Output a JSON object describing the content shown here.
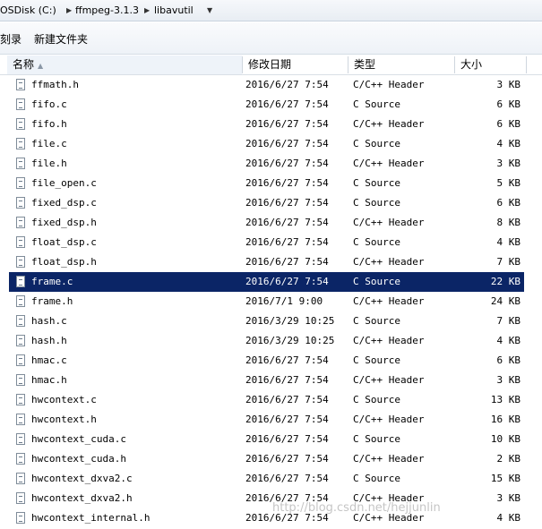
{
  "breadcrumb": [
    "OSDisk (C:)",
    "ffmpeg-3.1.3",
    "libavutil"
  ],
  "toolbar": {
    "left_label": "刻录",
    "new_folder_label": "新建文件夹"
  },
  "columns": {
    "name": "名称",
    "date": "修改日期",
    "type": "类型",
    "size": "大小"
  },
  "files": [
    {
      "name": "ffmath.h",
      "date": "2016/6/27 7:54",
      "type": "C/C++ Header",
      "size": "3 KB"
    },
    {
      "name": "fifo.c",
      "date": "2016/6/27 7:54",
      "type": "C Source",
      "size": "6 KB"
    },
    {
      "name": "fifo.h",
      "date": "2016/6/27 7:54",
      "type": "C/C++ Header",
      "size": "6 KB"
    },
    {
      "name": "file.c",
      "date": "2016/6/27 7:54",
      "type": "C Source",
      "size": "4 KB"
    },
    {
      "name": "file.h",
      "date": "2016/6/27 7:54",
      "type": "C/C++ Header",
      "size": "3 KB"
    },
    {
      "name": "file_open.c",
      "date": "2016/6/27 7:54",
      "type": "C Source",
      "size": "5 KB"
    },
    {
      "name": "fixed_dsp.c",
      "date": "2016/6/27 7:54",
      "type": "C Source",
      "size": "6 KB"
    },
    {
      "name": "fixed_dsp.h",
      "date": "2016/6/27 7:54",
      "type": "C/C++ Header",
      "size": "8 KB"
    },
    {
      "name": "float_dsp.c",
      "date": "2016/6/27 7:54",
      "type": "C Source",
      "size": "4 KB"
    },
    {
      "name": "float_dsp.h",
      "date": "2016/6/27 7:54",
      "type": "C/C++ Header",
      "size": "7 KB"
    },
    {
      "name": "frame.c",
      "date": "2016/6/27 7:54",
      "type": "C Source",
      "size": "22 KB",
      "selected": true
    },
    {
      "name": "frame.h",
      "date": "2016/7/1 9:00",
      "type": "C/C++ Header",
      "size": "24 KB"
    },
    {
      "name": "hash.c",
      "date": "2016/3/29 10:25",
      "type": "C Source",
      "size": "7 KB"
    },
    {
      "name": "hash.h",
      "date": "2016/3/29 10:25",
      "type": "C/C++ Header",
      "size": "4 KB"
    },
    {
      "name": "hmac.c",
      "date": "2016/6/27 7:54",
      "type": "C Source",
      "size": "6 KB"
    },
    {
      "name": "hmac.h",
      "date": "2016/6/27 7:54",
      "type": "C/C++ Header",
      "size": "3 KB"
    },
    {
      "name": "hwcontext.c",
      "date": "2016/6/27 7:54",
      "type": "C Source",
      "size": "13 KB"
    },
    {
      "name": "hwcontext.h",
      "date": "2016/6/27 7:54",
      "type": "C/C++ Header",
      "size": "16 KB"
    },
    {
      "name": "hwcontext_cuda.c",
      "date": "2016/6/27 7:54",
      "type": "C Source",
      "size": "10 KB"
    },
    {
      "name": "hwcontext_cuda.h",
      "date": "2016/6/27 7:54",
      "type": "C/C++ Header",
      "size": "2 KB"
    },
    {
      "name": "hwcontext_dxva2.c",
      "date": "2016/6/27 7:54",
      "type": "C Source",
      "size": "15 KB"
    },
    {
      "name": "hwcontext_dxva2.h",
      "date": "2016/6/27 7:54",
      "type": "C/C++ Header",
      "size": "3 KB"
    },
    {
      "name": "hwcontext_internal.h",
      "date": "2016/6/27 7:54",
      "type": "C/C++ Header",
      "size": "4 KB"
    }
  ],
  "watermark": "http://blog.csdn.net/hejjunlin",
  "colors": {
    "selection": "#0b2566",
    "selection_text": "#ffffff"
  }
}
